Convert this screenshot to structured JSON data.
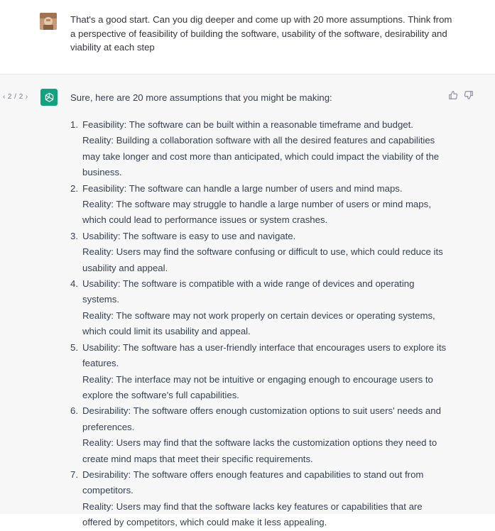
{
  "user_message": {
    "text": "That's a good start. Can you dig deeper and come up with 20 more assumptions. Think from a perspective of feasibility of building the software, usability of the software, desirability and viability at each step"
  },
  "assistant_message": {
    "pager": {
      "prev": "‹",
      "label": "2 / 2",
      "next": "›"
    },
    "intro": "Sure, here are 20 more assumptions that you might be making:",
    "items": [
      {
        "num": "1.",
        "assumption": "Feasibility: The software can be built within a reasonable timeframe and budget.",
        "reality": "Reality: Building a collaboration software with all the desired features and capabilities may take longer and cost more than anticipated, which could impact the viability of the business."
      },
      {
        "num": "2.",
        "assumption": "Feasibility: The software can handle a large number of users and mind maps.",
        "reality": "Reality: The software may struggle to handle a large number of users or mind maps, which could lead to performance issues or system crashes."
      },
      {
        "num": "3.",
        "assumption": "Usability: The software is easy to use and navigate.",
        "reality": "Reality: Users may find the software confusing or difficult to use, which could reduce its usability and appeal."
      },
      {
        "num": "4.",
        "assumption": "Usability: The software is compatible with a wide range of devices and operating systems.",
        "reality": "Reality: The software may not work properly on certain devices or operating systems, which could limit its usability and appeal."
      },
      {
        "num": "5.",
        "assumption": "Usability: The software has a user-friendly interface that encourages users to explore its features.",
        "reality": "Reality: The interface may not be intuitive or engaging enough to encourage users to explore the software's full capabilities."
      },
      {
        "num": "6.",
        "assumption": "Desirability: The software offers enough customization options to suit users' needs and preferences.",
        "reality": "Reality: Users may find that the software lacks the customization options they need to create mind maps that meet their specific requirements."
      },
      {
        "num": "7.",
        "assumption": "Desirability: The software offers enough features and capabilities to stand out from competitors.",
        "reality": "Reality: Users may find that the software lacks key features or capabilities that are offered by competitors, which could make it less appealing."
      }
    ]
  },
  "colors": {
    "brand": "#10a37f",
    "assistant_bg": "#f7f7f8",
    "text": "#374151"
  },
  "icons": [
    "user-avatar",
    "chatgpt-logo-icon",
    "thumbs-up-icon",
    "thumbs-down-icon"
  ]
}
